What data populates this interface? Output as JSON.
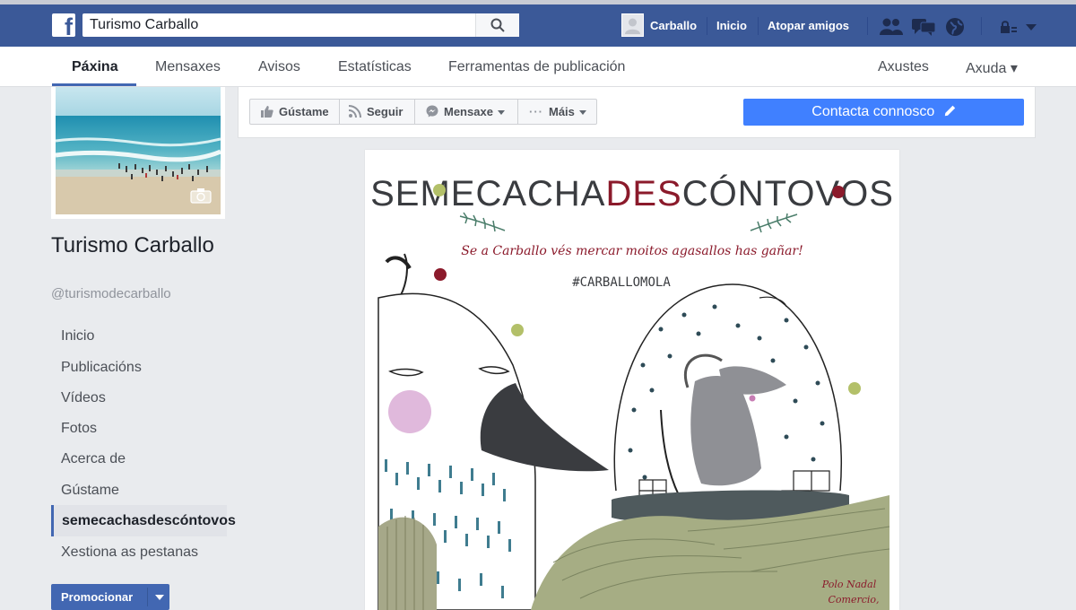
{
  "app": "Facebook",
  "search": {
    "value": "Turismo Carballo"
  },
  "topbar": {
    "profile_name": "Carballo",
    "links": [
      "Inicio",
      "Atopar amigos"
    ],
    "icons": [
      "friend-requests-icon",
      "messages-icon",
      "notifications-globe-icon",
      "privacy-lock-icon",
      "account-menu-caret-icon"
    ]
  },
  "subnav": {
    "tabs": [
      "Páxina",
      "Mensaxes",
      "Avisos",
      "Estatísticas",
      "Ferramentas de publicación"
    ],
    "active_tab": "Páxina",
    "right": [
      "Axustes",
      "Axuda ▾"
    ]
  },
  "page": {
    "name": "Turismo Carballo",
    "handle": "@turismodecarballo"
  },
  "sidebar": {
    "items": [
      "Inicio",
      "Publicacións",
      "Vídeos",
      "Fotos",
      "Acerca de",
      "Gústame",
      "semecachasdescóntovos",
      "Xestiona as pestanas"
    ],
    "active": "semecachasdescóntovos",
    "promote_label": "Promocionar"
  },
  "actions": {
    "like": "Gústame",
    "follow": "Seguir",
    "message": "Mensaxe",
    "more": "Máis",
    "contact": "Contacta connosco"
  },
  "post": {
    "title_parts": [
      "SEMECACHA",
      "DES",
      "CÓNTOVOS"
    ],
    "subtitle": "Se a Carballo vés mercar moitos agasallos has gañar!",
    "hashtag": "#CARBALLOMOLA",
    "footer_lines": [
      "Polo Nadal",
      "Comercio,"
    ]
  },
  "colors": {
    "topbar": "#3b5998",
    "accent": "#4267b2",
    "contact_button": "#4080ff",
    "title_red": "#8b1a2b"
  }
}
